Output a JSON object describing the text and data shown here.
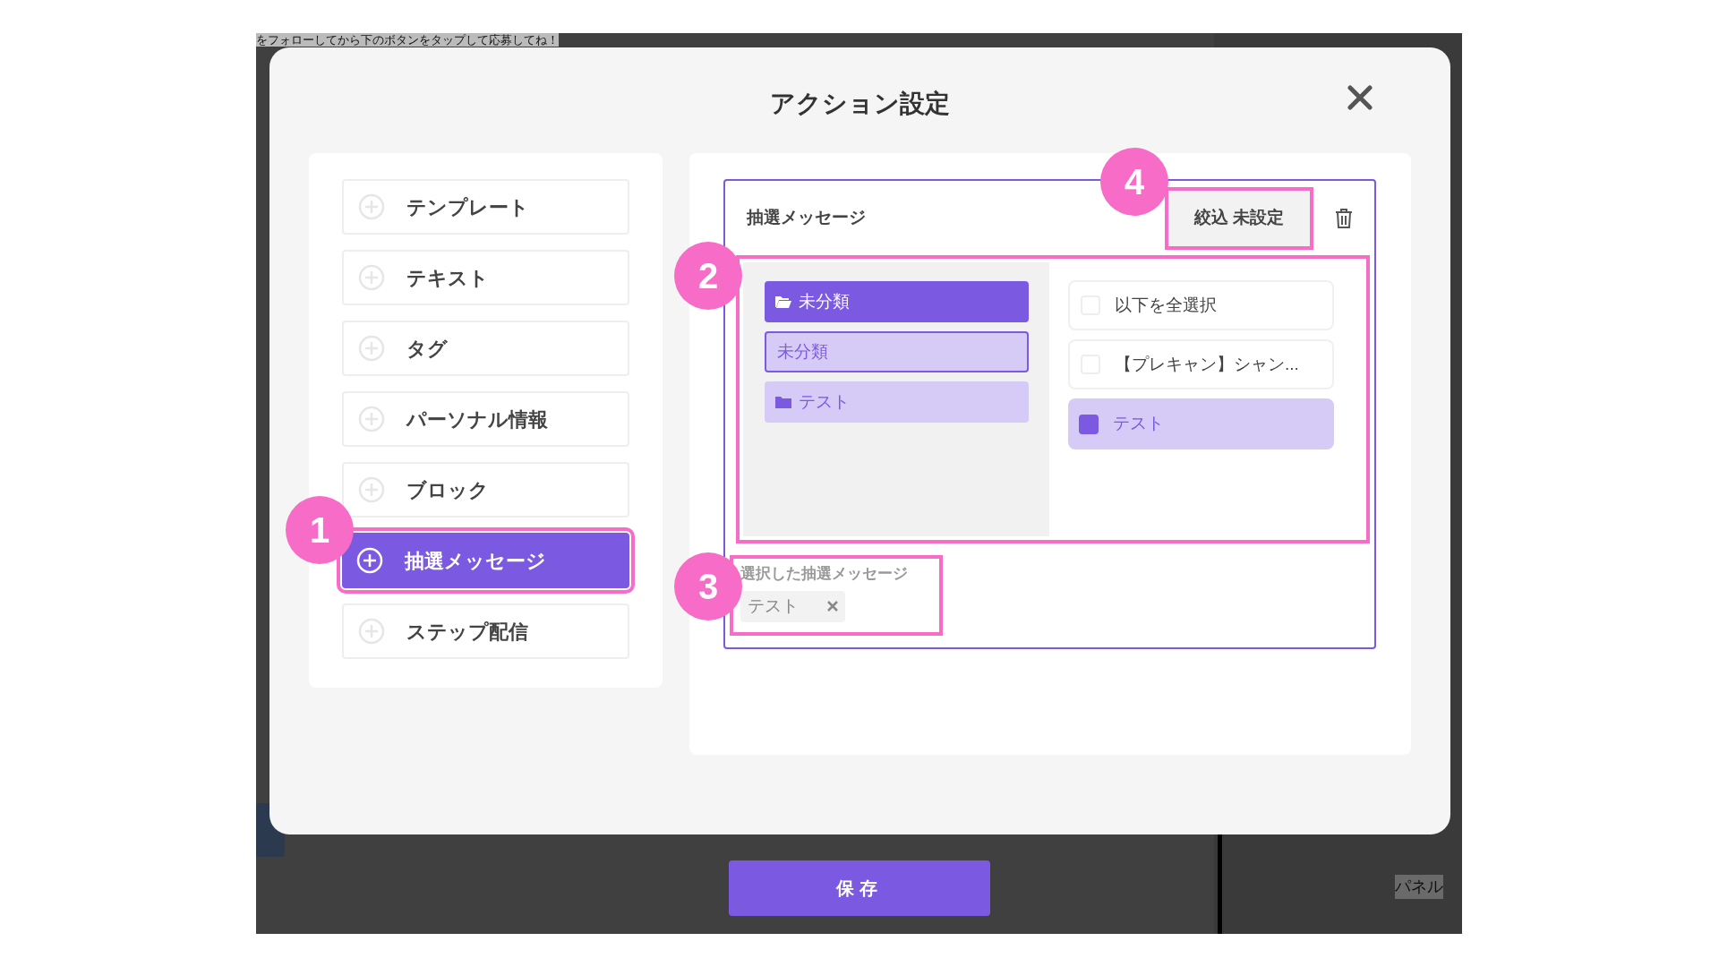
{
  "background": {
    "top_text": "をフォローしてから下のボタンをタップして応募してね！",
    "side_text": "パネル"
  },
  "modal": {
    "title": "アクション設定",
    "actions": [
      {
        "label": "テンプレート",
        "selected": false
      },
      {
        "label": "テキスト",
        "selected": false
      },
      {
        "label": "タグ",
        "selected": false
      },
      {
        "label": "パーソナル情報",
        "selected": false
      },
      {
        "label": "ブロック",
        "selected": false
      },
      {
        "label": "抽選メッセージ",
        "selected": true
      },
      {
        "label": "ステップ配信",
        "selected": false
      }
    ],
    "card": {
      "title": "抽選メッセージ",
      "filter_button": "絞込 未設定",
      "folders": [
        {
          "label": "未分類",
          "kind": "open_folder",
          "selected": true
        },
        {
          "label": "未分類",
          "kind": "entry",
          "selected": false
        },
        {
          "label": "テスト",
          "kind": "folder",
          "selected": false
        }
      ],
      "options": [
        {
          "label": "以下を全選択",
          "checked": false
        },
        {
          "label": "【プレキャン】シャン...",
          "checked": false
        },
        {
          "label": "テスト",
          "checked": true
        }
      ],
      "selected_label": "選択した抽選メッセージ",
      "chips": [
        {
          "label": "テスト"
        }
      ]
    }
  },
  "save_button": "保存",
  "annotations": [
    "1",
    "2",
    "3",
    "4"
  ]
}
